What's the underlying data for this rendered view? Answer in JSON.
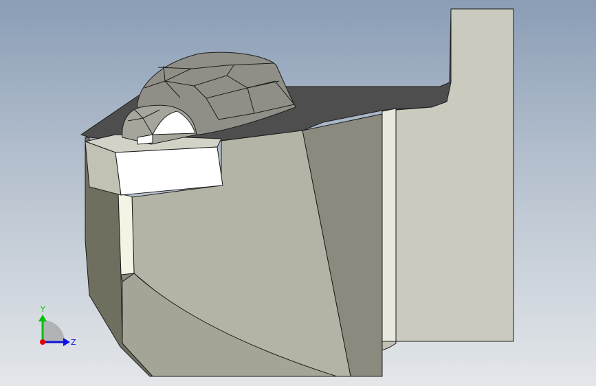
{
  "viewport": {
    "background_top": "#8a9db6",
    "background_bottom": "#e4e7ea"
  },
  "model": {
    "edge_color": "#1c1c1c",
    "face_colors": {
      "light": "#c9c9bd",
      "mid": "#b0b0a2",
      "dark": "#6f6f60",
      "shadow": "#4e4e4e",
      "highlight": "#ffffff"
    }
  },
  "triad": {
    "y_label": "Y",
    "z_label": "Z",
    "y_color": "#00c000",
    "z_color": "#1010e0",
    "x_color": "#e00000"
  }
}
